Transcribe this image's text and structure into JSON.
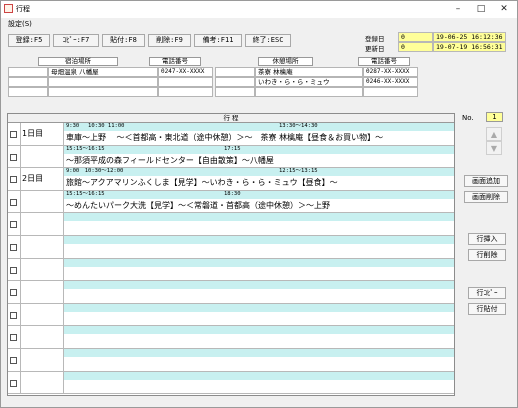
{
  "window": {
    "title": "行程",
    "min": "–",
    "max": "□",
    "close": "✕"
  },
  "menu": {
    "settings": "設定(S)"
  },
  "toolbar": {
    "register": "登録:F5",
    "copy": "ｺﾋﾟｰ:F7",
    "paste": "貼付:F8",
    "delete": "削除:F9",
    "note": "備考:F11",
    "exit": "終了:ESC"
  },
  "dates": {
    "registered_label": "登録日",
    "registered_value": "0",
    "registered_ts": "19-06-25 16:12:36",
    "updated_label": "更新日",
    "updated_value": "0",
    "updated_ts": "19-07-19 16:56:31"
  },
  "lodging": {
    "header_place": "宿泊場所",
    "header_phone": "電話番号",
    "rows": [
      {
        "place": "母畑温泉 八幡屋",
        "phone": "0247-XX-XXXX"
      },
      {
        "place": "",
        "phone": ""
      },
      {
        "place": "",
        "phone": ""
      }
    ]
  },
  "rest": {
    "header_place": "休憩場所",
    "header_phone": "電話番号",
    "rows": [
      {
        "place": "茶寮 林檎庵",
        "phone": "0287-XX-XXXX"
      },
      {
        "place": "いわき・ら・ら・ミュウ",
        "phone": "0246-XX-XXXX"
      },
      {
        "place": "",
        "phone": ""
      }
    ]
  },
  "itinerary": {
    "header": "行 程",
    "no_label": "No.",
    "no_value": "1",
    "rows": [
      {
        "day": "1日目",
        "times": "9:30　 10:30 11:00",
        "times2": "13:30～14:30",
        "text": "車庫～上野　 ～＜首都高・東北道（途中休憩）＞～　茶寮 林檎庵【昼食＆お買い物】～"
      },
      {
        "day": "",
        "times": "15:15～16:15",
        "times2": "17:15",
        "text": "～那須平成の森フィールドセンター【自由散策】～八幡屋"
      },
      {
        "day": "2日目",
        "times": "9:00　10:30～12:00",
        "times2": "12:15～13:15",
        "text": "旅館～アクアマリンふくしま【見学】～いわき・ら・ら・ミュウ【昼食】～"
      },
      {
        "day": "",
        "times": "15:15～16:15",
        "times2": "18:30",
        "text": "～めんたいパーク大洗【見学】～＜常磐道・首都高（途中休憩）＞～上野"
      },
      {
        "day": "",
        "times": "",
        "times2": "",
        "text": ""
      },
      {
        "day": "",
        "times": "",
        "times2": "",
        "text": ""
      },
      {
        "day": "",
        "times": "",
        "times2": "",
        "text": ""
      },
      {
        "day": "",
        "times": "",
        "times2": "",
        "text": ""
      },
      {
        "day": "",
        "times": "",
        "times2": "",
        "text": ""
      },
      {
        "day": "",
        "times": "",
        "times2": "",
        "text": ""
      },
      {
        "day": "",
        "times": "",
        "times2": "",
        "text": ""
      },
      {
        "day": "",
        "times": "",
        "times2": "",
        "text": ""
      }
    ]
  },
  "side": {
    "up": "▲",
    "down": "▼",
    "add_screen": "画面追加",
    "delete_screen": "画面削除",
    "insert_row": "行挿入",
    "delete_row": "行削除",
    "copy_row": "行ｺﾋﾟｰ",
    "paste_row": "行貼付"
  },
  "colors": {
    "strip": "#c8f0f0",
    "no_box": "#ffff99",
    "date_box": "#ffff99"
  }
}
